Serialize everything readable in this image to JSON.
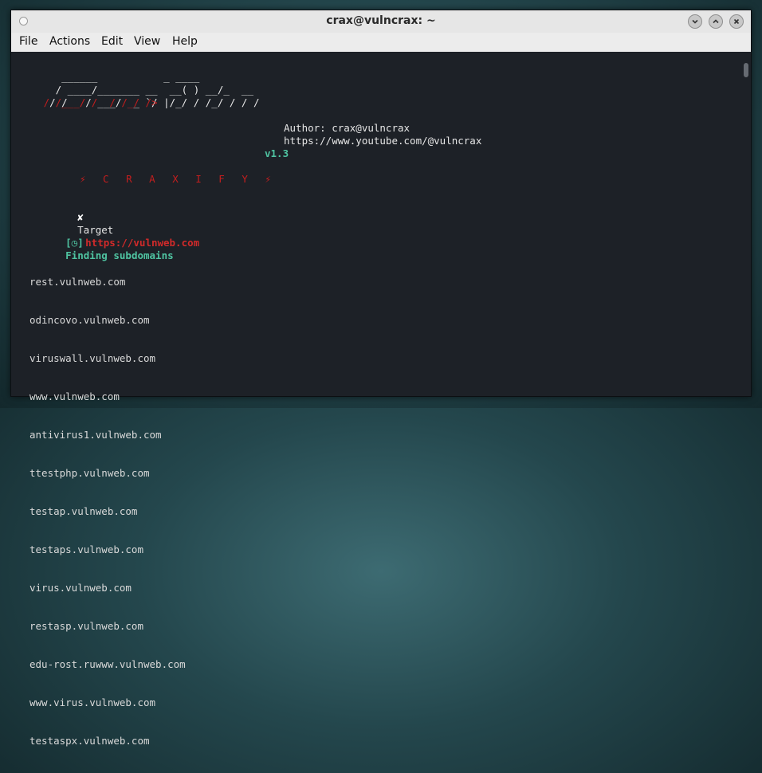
{
  "window": {
    "title": "crax@vulncrax: ~",
    "buttons": [
      "minimize",
      "maximize",
      "close"
    ]
  },
  "menu": [
    "File",
    "Actions",
    "Edit",
    "View",
    "Help"
  ],
  "banner": {
    "author": "Author: crax@vulncrax",
    "channel": "https://www.youtube.com/@vulncrax",
    "version": "v1.3",
    "tagline": "⚡ C R A X I F Y ⚡"
  },
  "target": {
    "mark": "✘",
    "label": "Target",
    "url": "https://vulnweb.com"
  },
  "status": {
    "text": "Finding subdomains",
    "prefix": "[◷]"
  },
  "subdomains": [
    "rest.vulnweb.com",
    "odincovo.vulnweb.com",
    "viruswall.vulnweb.com",
    "www.vulnweb.com",
    "antivirus1.vulnweb.com",
    "ttestphp.vulnweb.com",
    "testap.vulnweb.com",
    "testaps.vulnweb.com",
    "virus.vulnweb.com",
    "restasp.vulnweb.com",
    "edu-rost.ruwww.vulnweb.com",
    "www.virus.vulnweb.com",
    "testaspx.vulnweb.com"
  ],
  "colors": {
    "accent_green": "#4fc3a1",
    "accent_red": "#c41e1e",
    "terminal_bg": "#1d2127"
  }
}
